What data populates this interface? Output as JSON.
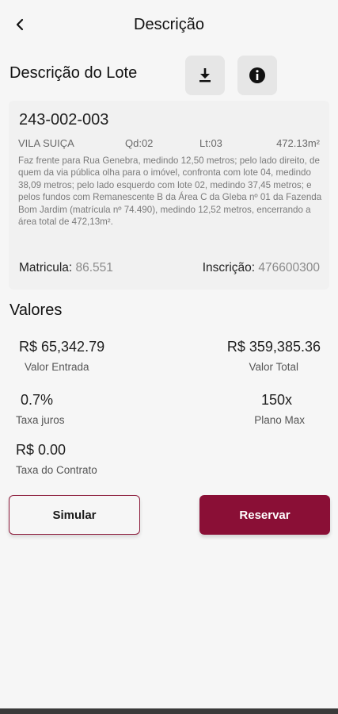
{
  "header": {
    "title": "Descrição",
    "back_icon": "back-arrow-icon"
  },
  "lote_section": {
    "title": "Descrição do Lote",
    "download_icon": "download-icon",
    "info_icon": "info-icon"
  },
  "card": {
    "code": "243-002-003",
    "neighborhood": "VILA SUIÇA",
    "quadra": "Qd:02",
    "lote": "Lt:03",
    "area": "472.13m²",
    "description": "Faz frente para Rua Genebra, medindo 12,50 metros; pelo lado direito, de quem da via pública olha para o imóvel, confronta com lote 04, medindo 38,09 metros; pelo lado esquerdo com lote 02, medindo 37,45 metros; e pelos fundos com Remanescente B da Área C da Gleba nº 01 da Fazenda Bom Jardim (matrícula nº 74.490), medindo 12,52 metros, encerrando a área total de 472,13m².",
    "matricula_label": "Matricula:",
    "matricula_value": "86.551",
    "inscricao_label": "Inscrição:",
    "inscricao_value": "476600300"
  },
  "valores": {
    "title": "Valores",
    "entrada_value": "R$ 65,342.79",
    "entrada_label": "Valor Entrada",
    "total_value": "R$ 359,385.36",
    "total_label": "Valor Total",
    "juros_value": "0.7%",
    "juros_label": "Taxa juros",
    "plano_value": "150x",
    "plano_label": "Plano Max",
    "contrato_value": "R$ 0.00",
    "contrato_label": "Taxa do Contrato"
  },
  "actions": {
    "simular": "Simular",
    "reservar": "Reservar"
  },
  "colors": {
    "primary": "#8a0f36",
    "background": "#f6f6f6",
    "card": "#f1f1f1"
  }
}
